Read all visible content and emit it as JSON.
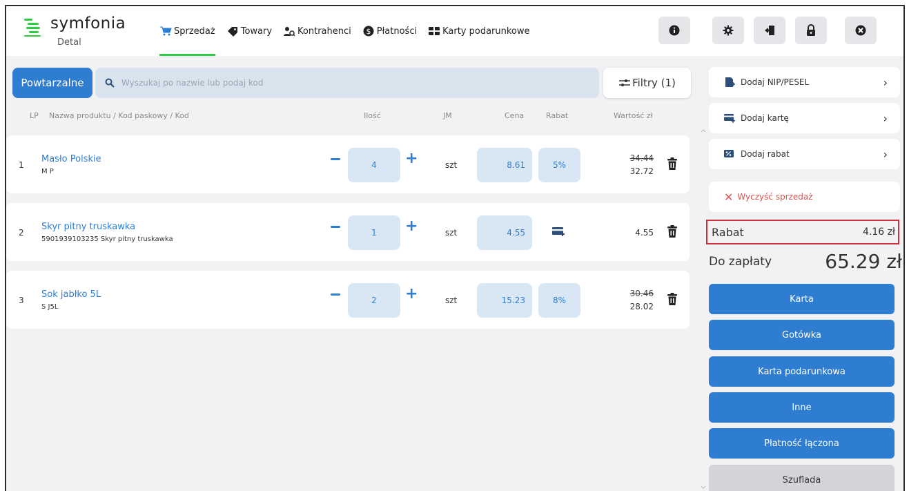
{
  "app": {
    "logo_text": "symfonia",
    "logo_sub": "Detal",
    "brand_color": "#2ecc40",
    "accent_color": "#2e7dd1"
  },
  "nav": [
    {
      "label": "Sprzedaż",
      "icon": "cart-icon",
      "active": true
    },
    {
      "label": "Towary",
      "icon": "tag-icon",
      "active": false
    },
    {
      "label": "Kontrahenci",
      "icon": "users-icon",
      "active": false
    },
    {
      "label": "Płatności",
      "icon": "dollar-icon",
      "active": false
    },
    {
      "label": "Karty podarunkowe",
      "icon": "gift-card-icon",
      "active": false
    }
  ],
  "header_buttons": [
    {
      "icon": "info-icon"
    },
    {
      "icon": "gear-icon"
    },
    {
      "icon": "logout-icon"
    },
    {
      "icon": "lock-icon"
    },
    {
      "icon": "close-icon"
    }
  ],
  "toolbar": {
    "powtarzalne_label": "Powtarzalne",
    "search_placeholder": "Wyszukaj po nazwie lub podaj kod",
    "filter_label": "Filtry (1)"
  },
  "columns": {
    "lp": "LP",
    "name": "Nazwa produktu / Kod paskowy / Kod",
    "qty": "Ilość",
    "jm": "JM",
    "price": "Cena",
    "discount": "Rabat",
    "value": "Wartość zł"
  },
  "rows": [
    {
      "lp": "1",
      "name": "Masło Polskie",
      "code": "M P",
      "qty": "4",
      "jm": "szt",
      "price": "8.61",
      "discount": "5%",
      "value_old": "34.44",
      "value": "32.72"
    },
    {
      "lp": "2",
      "name": "Skyr pitny truskawka",
      "code": "5901939103235 Skyr pitny truskawka",
      "qty": "1",
      "jm": "szt",
      "price": "4.55",
      "discount": "",
      "value_old": "",
      "value": "4.55"
    },
    {
      "lp": "3",
      "name": "Sok jabłko 5L",
      "code": "S J5L",
      "qty": "2",
      "jm": "szt",
      "price": "15.23",
      "discount": "8%",
      "value_old": "30.46",
      "value": "28.02"
    }
  ],
  "side": {
    "nip_label": "Dodaj NIP/PESEL",
    "card_label": "Dodaj kartę",
    "discount_label": "Dodaj rabat",
    "clear_label": "Wyczyść sprzedaż",
    "rabat_label": "Rabat",
    "rabat_value": "4.16 zł",
    "to_pay_label": "Do zapłaty",
    "to_pay_value": "65.29 zł"
  },
  "payments": [
    {
      "label": "Karta"
    },
    {
      "label": "Gotówka"
    },
    {
      "label": "Karta podarunkowa"
    },
    {
      "label": "Inne"
    },
    {
      "label": "Płatność łączona"
    },
    {
      "label": "Szuflada"
    }
  ]
}
